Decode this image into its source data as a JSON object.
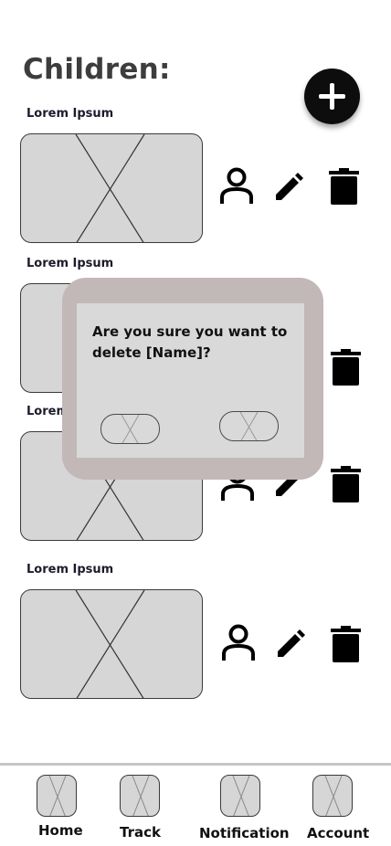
{
  "header": {
    "title": "Children:"
  },
  "children": [
    {
      "name": "Lorem Ipsum"
    },
    {
      "name": "Lorem Ipsum"
    },
    {
      "name": "Lorem Ipsum"
    },
    {
      "name": "Lorem Ipsum"
    }
  ],
  "dialog": {
    "message": "Are you sure you want to delete [Name]?"
  },
  "nav": {
    "items": [
      {
        "label": "Home"
      },
      {
        "label": "Track"
      },
      {
        "label": "Notification"
      },
      {
        "label": "Account"
      }
    ]
  },
  "icons": {
    "add": "plus-icon",
    "profile": "person-icon",
    "edit": "pencil-icon",
    "delete": "trash-icon"
  },
  "colors": {
    "placeholder_fill": "#d6d6d6",
    "dialog_frame": "#c2b8b8",
    "dialog_body": "#d9d9d9",
    "add_button": "#0d0d0d"
  }
}
